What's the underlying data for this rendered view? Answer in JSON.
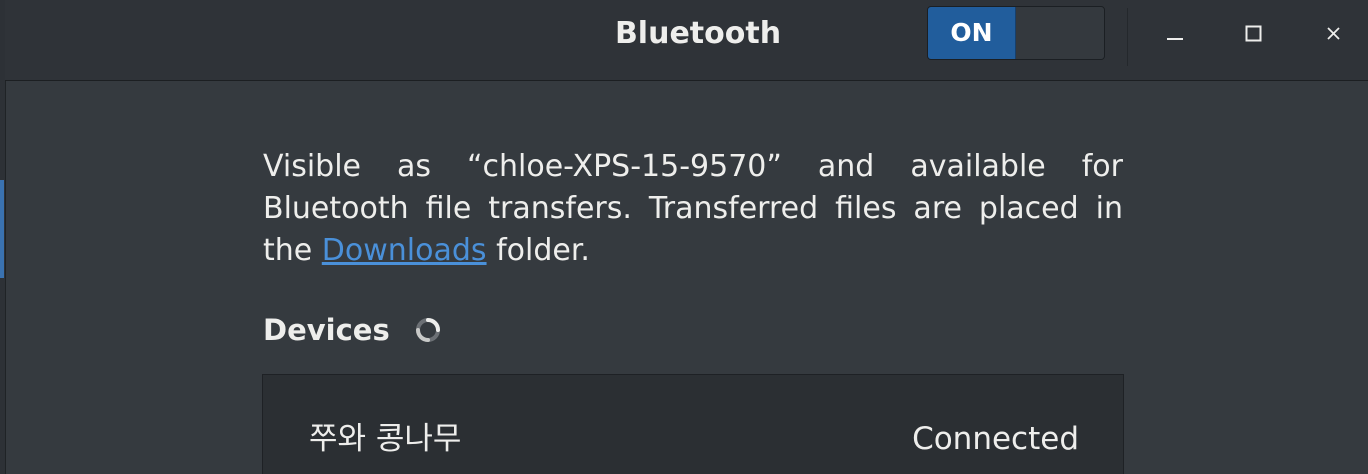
{
  "window": {
    "title": "Bluetooth",
    "switch_label": "ON",
    "minimize_icon": "minimize-icon",
    "maximize_icon": "maximize-icon",
    "close_icon": "close-icon"
  },
  "info": {
    "text_before": "Visible as “chloe-XPS-15-9570” and available for Bluetooth file transfers. Transferred files are placed in the ",
    "link": "Downloads",
    "text_after": " folder."
  },
  "devices": {
    "heading": "Devices",
    "spinner_icon": "loading-spinner-icon",
    "items": [
      {
        "name": "쭈와 콩나무",
        "status": "Connected"
      }
    ]
  },
  "colors": {
    "accent": "#215d9c",
    "link": "#4a90d9",
    "background": "#353a3f"
  }
}
